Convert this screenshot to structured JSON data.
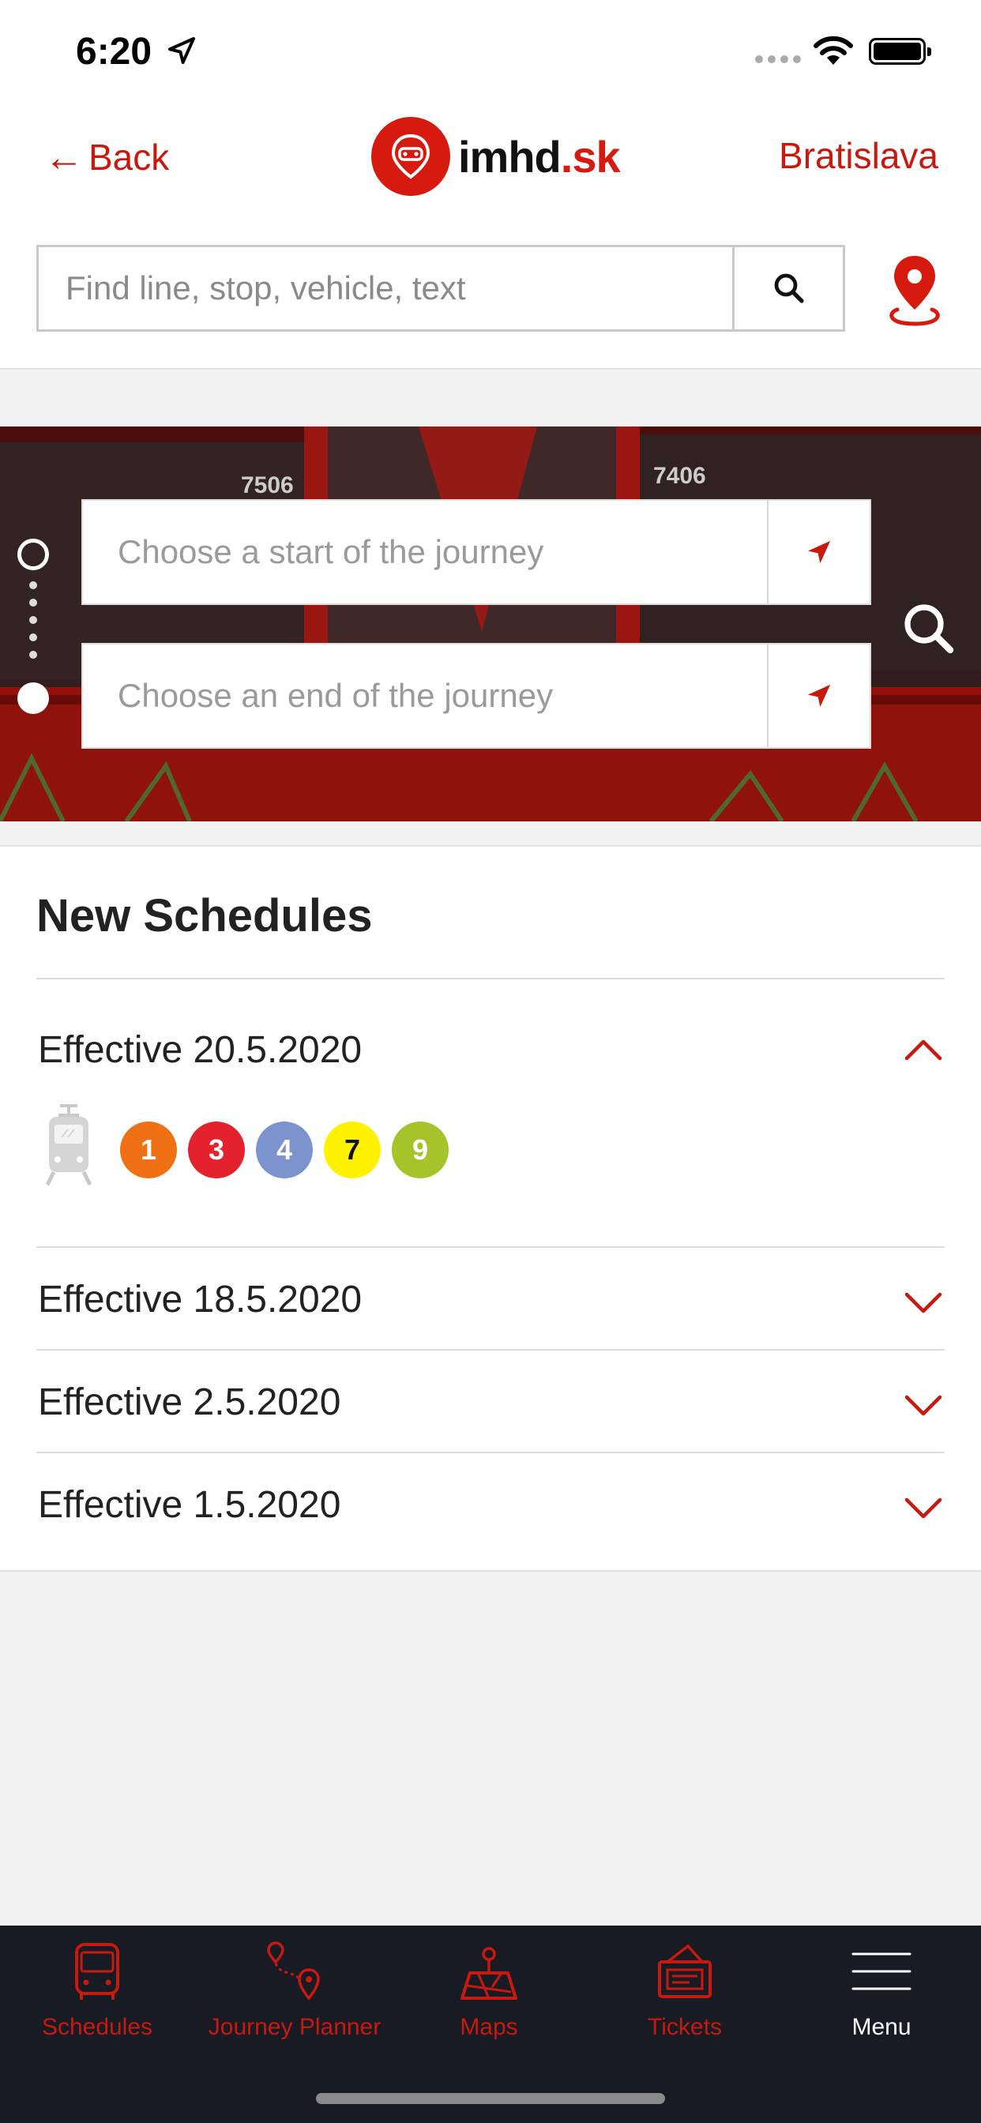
{
  "status_bar": {
    "time": "6:20"
  },
  "header": {
    "back_label": "Back",
    "logo_text": "imhd",
    "logo_suffix": ".sk",
    "city": "Bratislava",
    "search_placeholder": "Find line, stop, vehicle, text"
  },
  "journey": {
    "start_placeholder": "Choose a start of the journey",
    "end_placeholder": "Choose an end of the journey",
    "vehicle_numbers": [
      "7506",
      "7406"
    ]
  },
  "schedules": {
    "title": "New Schedules",
    "groups": [
      {
        "label": "Effective 20.5.2020",
        "expanded": true,
        "lines": [
          {
            "number": "1",
            "color": "#f07014"
          },
          {
            "number": "3",
            "color": "#e4222d"
          },
          {
            "number": "4",
            "color": "#7d93cf"
          },
          {
            "number": "7",
            "color": "#fff200"
          },
          {
            "number": "9",
            "color": "#a5c42a"
          }
        ]
      },
      {
        "label": "Effective 18.5.2020",
        "expanded": false
      },
      {
        "label": "Effective 2.5.2020",
        "expanded": false
      },
      {
        "label": "Effective 1.5.2020",
        "expanded": false
      }
    ]
  },
  "tabbar": {
    "items": [
      {
        "label": "Schedules",
        "icon": "bus-icon"
      },
      {
        "label": "Journey Planner",
        "icon": "route-icon"
      },
      {
        "label": "Maps",
        "icon": "map-icon"
      },
      {
        "label": "Tickets",
        "icon": "ticket-icon"
      },
      {
        "label": "Menu",
        "icon": "hamburger-icon"
      }
    ]
  },
  "colors": {
    "accent": "#c8190e",
    "tabbar_bg": "#181b24"
  }
}
